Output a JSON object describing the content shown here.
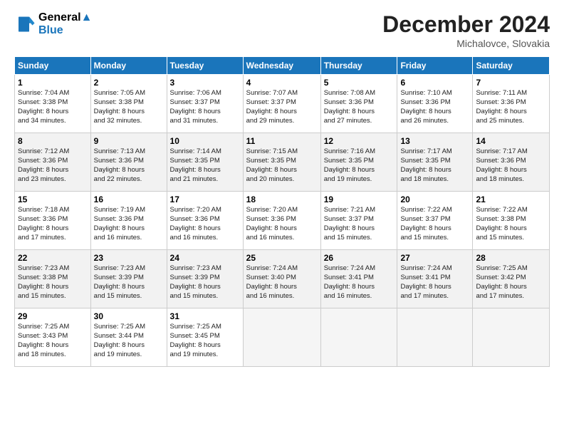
{
  "header": {
    "logo_line1": "General",
    "logo_line2": "Blue",
    "month": "December 2024",
    "location": "Michalovce, Slovakia"
  },
  "weekdays": [
    "Sunday",
    "Monday",
    "Tuesday",
    "Wednesday",
    "Thursday",
    "Friday",
    "Saturday"
  ],
  "weeks": [
    [
      {
        "day": "1",
        "info": "Sunrise: 7:04 AM\nSunset: 3:38 PM\nDaylight: 8 hours\nand 34 minutes."
      },
      {
        "day": "2",
        "info": "Sunrise: 7:05 AM\nSunset: 3:38 PM\nDaylight: 8 hours\nand 32 minutes."
      },
      {
        "day": "3",
        "info": "Sunrise: 7:06 AM\nSunset: 3:37 PM\nDaylight: 8 hours\nand 31 minutes."
      },
      {
        "day": "4",
        "info": "Sunrise: 7:07 AM\nSunset: 3:37 PM\nDaylight: 8 hours\nand 29 minutes."
      },
      {
        "day": "5",
        "info": "Sunrise: 7:08 AM\nSunset: 3:36 PM\nDaylight: 8 hours\nand 27 minutes."
      },
      {
        "day": "6",
        "info": "Sunrise: 7:10 AM\nSunset: 3:36 PM\nDaylight: 8 hours\nand 26 minutes."
      },
      {
        "day": "7",
        "info": "Sunrise: 7:11 AM\nSunset: 3:36 PM\nDaylight: 8 hours\nand 25 minutes."
      }
    ],
    [
      {
        "day": "8",
        "info": "Sunrise: 7:12 AM\nSunset: 3:36 PM\nDaylight: 8 hours\nand 23 minutes."
      },
      {
        "day": "9",
        "info": "Sunrise: 7:13 AM\nSunset: 3:36 PM\nDaylight: 8 hours\nand 22 minutes."
      },
      {
        "day": "10",
        "info": "Sunrise: 7:14 AM\nSunset: 3:35 PM\nDaylight: 8 hours\nand 21 minutes."
      },
      {
        "day": "11",
        "info": "Sunrise: 7:15 AM\nSunset: 3:35 PM\nDaylight: 8 hours\nand 20 minutes."
      },
      {
        "day": "12",
        "info": "Sunrise: 7:16 AM\nSunset: 3:35 PM\nDaylight: 8 hours\nand 19 minutes."
      },
      {
        "day": "13",
        "info": "Sunrise: 7:17 AM\nSunset: 3:35 PM\nDaylight: 8 hours\nand 18 minutes."
      },
      {
        "day": "14",
        "info": "Sunrise: 7:17 AM\nSunset: 3:36 PM\nDaylight: 8 hours\nand 18 minutes."
      }
    ],
    [
      {
        "day": "15",
        "info": "Sunrise: 7:18 AM\nSunset: 3:36 PM\nDaylight: 8 hours\nand 17 minutes."
      },
      {
        "day": "16",
        "info": "Sunrise: 7:19 AM\nSunset: 3:36 PM\nDaylight: 8 hours\nand 16 minutes."
      },
      {
        "day": "17",
        "info": "Sunrise: 7:20 AM\nSunset: 3:36 PM\nDaylight: 8 hours\nand 16 minutes."
      },
      {
        "day": "18",
        "info": "Sunrise: 7:20 AM\nSunset: 3:36 PM\nDaylight: 8 hours\nand 16 minutes."
      },
      {
        "day": "19",
        "info": "Sunrise: 7:21 AM\nSunset: 3:37 PM\nDaylight: 8 hours\nand 15 minutes."
      },
      {
        "day": "20",
        "info": "Sunrise: 7:22 AM\nSunset: 3:37 PM\nDaylight: 8 hours\nand 15 minutes."
      },
      {
        "day": "21",
        "info": "Sunrise: 7:22 AM\nSunset: 3:38 PM\nDaylight: 8 hours\nand 15 minutes."
      }
    ],
    [
      {
        "day": "22",
        "info": "Sunrise: 7:23 AM\nSunset: 3:38 PM\nDaylight: 8 hours\nand 15 minutes."
      },
      {
        "day": "23",
        "info": "Sunrise: 7:23 AM\nSunset: 3:39 PM\nDaylight: 8 hours\nand 15 minutes."
      },
      {
        "day": "24",
        "info": "Sunrise: 7:23 AM\nSunset: 3:39 PM\nDaylight: 8 hours\nand 15 minutes."
      },
      {
        "day": "25",
        "info": "Sunrise: 7:24 AM\nSunset: 3:40 PM\nDaylight: 8 hours\nand 16 minutes."
      },
      {
        "day": "26",
        "info": "Sunrise: 7:24 AM\nSunset: 3:41 PM\nDaylight: 8 hours\nand 16 minutes."
      },
      {
        "day": "27",
        "info": "Sunrise: 7:24 AM\nSunset: 3:41 PM\nDaylight: 8 hours\nand 17 minutes."
      },
      {
        "day": "28",
        "info": "Sunrise: 7:25 AM\nSunset: 3:42 PM\nDaylight: 8 hours\nand 17 minutes."
      }
    ],
    [
      {
        "day": "29",
        "info": "Sunrise: 7:25 AM\nSunset: 3:43 PM\nDaylight: 8 hours\nand 18 minutes."
      },
      {
        "day": "30",
        "info": "Sunrise: 7:25 AM\nSunset: 3:44 PM\nDaylight: 8 hours\nand 19 minutes."
      },
      {
        "day": "31",
        "info": "Sunrise: 7:25 AM\nSunset: 3:45 PM\nDaylight: 8 hours\nand 19 minutes."
      },
      null,
      null,
      null,
      null
    ]
  ]
}
